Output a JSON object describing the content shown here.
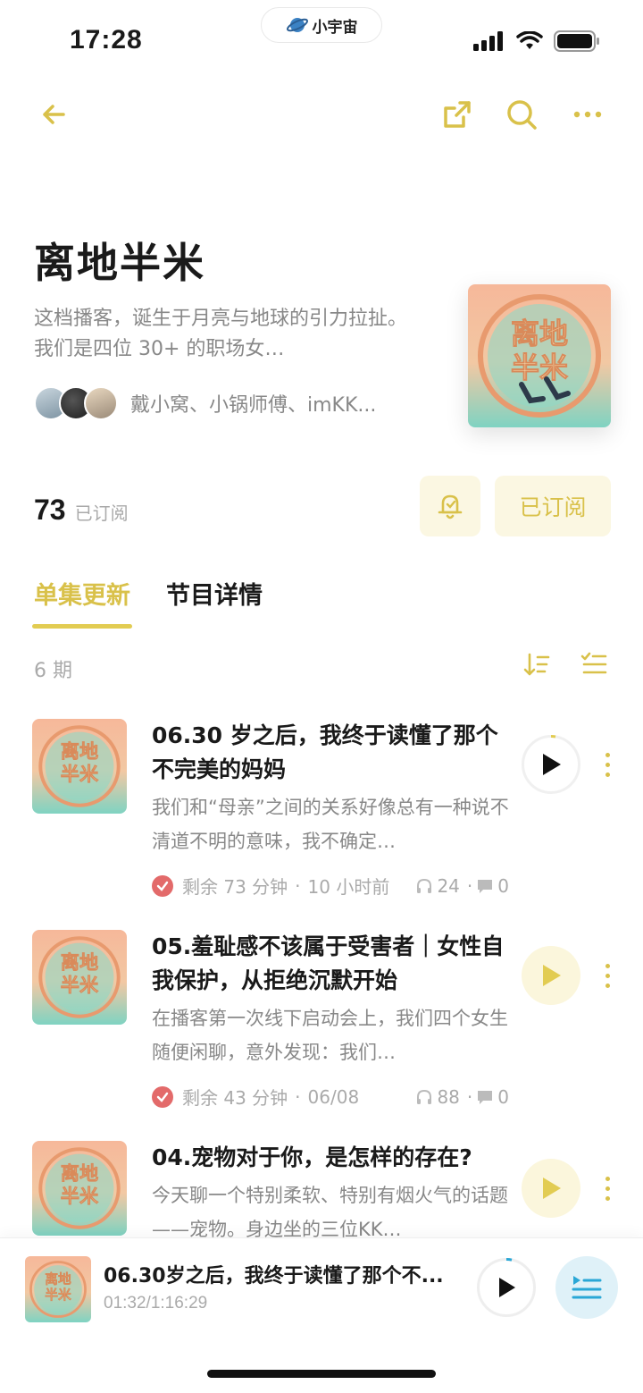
{
  "status_bar": {
    "time": "17:28",
    "app_badge": "小宇宙"
  },
  "podcast": {
    "title": "离地半米",
    "description": "这档播客，诞生于月亮与地球的引力拉扯。 我们是四位 30+ 的职场女…",
    "hosts_text": "戴小窝、小锅师傅、imKK...",
    "cover_text_line1": "离地",
    "cover_text_line2": "半米",
    "subscriber_count": "73",
    "subscriber_label": "已订阅",
    "subscribe_button_label": "已订阅"
  },
  "tabs": [
    {
      "label": "单集更新",
      "active": true
    },
    {
      "label": "节目详情",
      "active": false
    }
  ],
  "episode_count": "6 期",
  "episodes": [
    {
      "title": "06.30 岁之后，我终于读懂了那个不完美的妈妈",
      "description": "我们和“母亲”之间的关系好像总有一种说不清道不明的意味，我不确定…",
      "remaining": "剩余 73 分钟",
      "date": "10 小时前",
      "plays": "24",
      "comments": "0",
      "playing": true
    },
    {
      "title": "05.羞耻感不该属于受害者｜女性自我保护，从拒绝沉默开始",
      "description": "在播客第一次线下启动会上，我们四个女生随便闲聊，意外发现：我们…",
      "remaining": "剩余 43 分钟",
      "date": "06/08",
      "plays": "88",
      "comments": "0",
      "playing": false
    },
    {
      "title": "04.宠物对于你，是怎样的存在?",
      "description": "今天聊一个特别柔软、特别有烟火气的话题——宠物。身边坐的三位KK…",
      "playing": false
    }
  ],
  "mini_player": {
    "title": "06.30岁之后，我终于读懂了那个不...",
    "time": "01:32/1:16:29"
  },
  "colors": {
    "accent": "#d9c14a",
    "accent_bg": "#fbf7e2",
    "check": "#e36a6a",
    "playlist_bg": "#dff1f8",
    "playlist_icon": "#2aa7d6"
  }
}
